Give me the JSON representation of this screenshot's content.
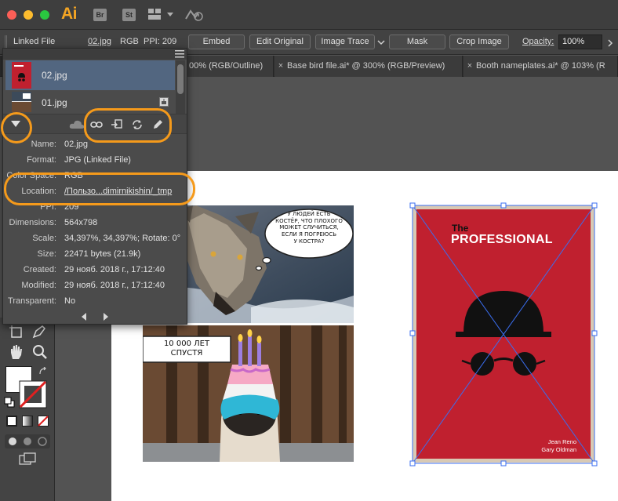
{
  "app": {
    "name": "Ai",
    "bridge_label": "Br",
    "stock_label": "St"
  },
  "control_bar": {
    "linked_file_label": "Linked File",
    "file_name": "02.jpg",
    "color_mode": "RGB",
    "ppi_label": "PPI: 209",
    "embed_label": "Embed",
    "edit_original_label": "Edit Original",
    "image_trace_label": "Image Trace",
    "mask_label": "Mask",
    "crop_image_label": "Crop Image",
    "opacity_label": "Opacity:",
    "opacity_value": "100%"
  },
  "tabs": [
    {
      "label": "00% (RGB/Outline)"
    },
    {
      "label": "Base bird file.ai* @ 300% (RGB/Preview)"
    },
    {
      "label": "Booth nameplates.ai* @ 103% (R"
    }
  ],
  "links_panel": {
    "items": [
      {
        "name": "02.jpg",
        "selected": true
      },
      {
        "name": "01.jpg",
        "selected": false
      }
    ],
    "info": [
      {
        "label": "Name:",
        "value": "02.jpg"
      },
      {
        "label": "Format:",
        "value": "JPG (Linked File)"
      },
      {
        "label": "Color Space:",
        "value": "RGB"
      },
      {
        "label": "Location:",
        "value": "/Пользо...dimirnikishin/_tmp"
      },
      {
        "label": "PPI:",
        "value": "209"
      },
      {
        "label": "Dimensions:",
        "value": "564x798"
      },
      {
        "label": "Scale:",
        "value": "34,397%, 34,397%; Rotate: 0°"
      },
      {
        "label": "Size:",
        "value": "22471 bytes (21.9k)"
      },
      {
        "label": "Created:",
        "value": "29 нояб. 2018 г., 17:12:40"
      },
      {
        "label": "Modified:",
        "value": "29 нояб. 2018 г., 17:12:40"
      },
      {
        "label": "Transparent:",
        "value": "No"
      }
    ]
  },
  "artwork": {
    "wolf_bubble_lines": [
      "У ЛЮДЕЙ ЕСТЬ",
      "КОСТЁР, ЧТО ПЛОХОГО",
      "МОЖЕТ СЛУЧИТЬСЯ,",
      "ЕСЛИ Я ПОГРЕЮСЬ",
      "У КОСТРА?"
    ],
    "pug_caption_lines": [
      "10 000 ЛЕТ",
      "СПУСТЯ"
    ],
    "poster_the": "The",
    "poster_title": "PROFESSIONAL",
    "poster_credits": [
      "Jean Reno",
      "Gary Oldman"
    ]
  },
  "colors": {
    "highlight": "#f59a1b",
    "poster_red": "#c0202f",
    "selection_blue": "#3a6ef0",
    "panel_selected": "#526680"
  },
  "icons": [
    "close-dot-icon",
    "minimize-dot-icon",
    "zoom-dot-icon",
    "workspace-grid-icon",
    "gpu-performance-icon",
    "panel-menu-icon",
    "disclosure-triangle-icon",
    "cloud-link-icon",
    "relink-icon",
    "go-to-link-icon",
    "update-link-icon",
    "edit-original-icon",
    "link-badge-icon",
    "prev-arrow-icon",
    "next-arrow-icon",
    "hand-tool-icon",
    "zoom-tool-icon",
    "pen-tool-icon",
    "artboard-tool-icon"
  ]
}
